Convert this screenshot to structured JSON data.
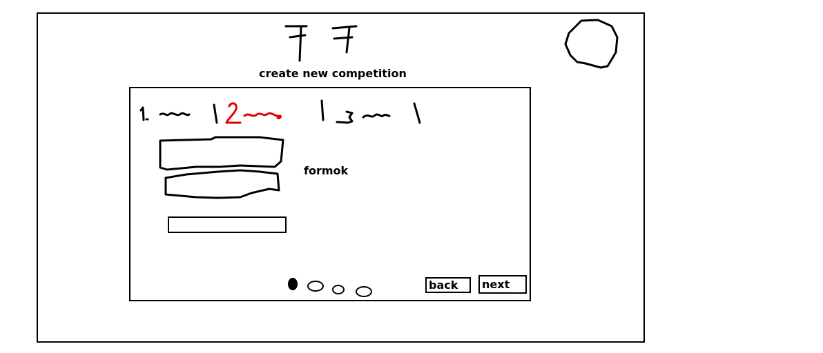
{
  "header": {
    "title": "create new competition"
  },
  "form": {
    "label": "formok",
    "input_value": "",
    "input_placeholder": ""
  },
  "steps": {
    "count": 3,
    "current": 2
  },
  "pager": {
    "dot_count": 4,
    "active_index": 0
  },
  "nav": {
    "back_label": "back",
    "next_label": "next"
  },
  "colors": {
    "ink": "#000000",
    "active_step": "#e00000",
    "background": "#ffffff"
  }
}
